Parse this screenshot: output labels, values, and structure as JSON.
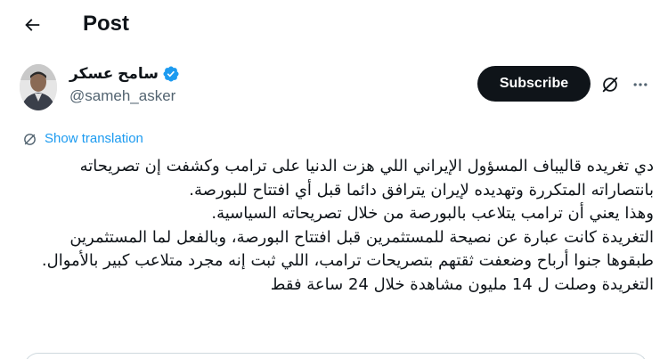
{
  "header": {
    "title": "Post"
  },
  "author": {
    "display_name": "سامح عسكر",
    "handle": "@sameh_asker",
    "verified": true
  },
  "actions": {
    "subscribe_label": "Subscribe"
  },
  "translation": {
    "label": "Show translation"
  },
  "tweet": {
    "paragraphs": [
      "دي تغريده قاليباف المسؤول الإيراني اللي هزت الدنيا على ترامب وكشفت إن تصريحاته بانتصاراته المتكررة وتهديده لإيران يترافق دائما قبل أي افتتاح للبورصة.",
      "وهذا يعني أن ترامب يتلاعب بالبورصة من خلال تصريحاته السياسية.",
      "التغريدة كانت عبارة عن نصيحة للمستثمرين قبل افتتاح البورصة، وبالفعل لما المستثمرين طبقوها جنوا أرباح وضعفت ثقتهم بتصريحات ترامب، اللي ثبت إنه مجرد متلاعب كبير بالأموال.",
      "التغريدة وصلت ل 14 مليون مشاهدة خلال 24 ساعة فقط"
    ]
  },
  "icons": {
    "back": "arrow-left-icon",
    "verified": "verified-badge-icon",
    "grok": "grok-icon",
    "more": "more-horizontal-icon",
    "translate": "globe-translate-icon"
  },
  "colors": {
    "accent": "#1d9bf0",
    "text": "#0f1419",
    "muted": "#536471",
    "button_bg": "#0f1419"
  }
}
